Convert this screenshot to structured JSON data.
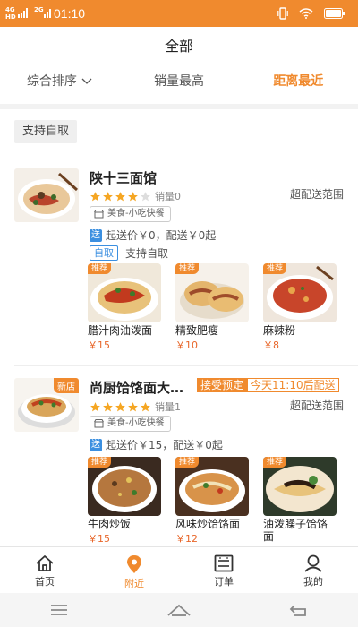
{
  "status_bar": {
    "net_top": "4G",
    "net_sub": "HD",
    "net2_top": "2G",
    "net2_sub": "",
    "time": "01:10"
  },
  "header": {
    "title": "全部"
  },
  "sort_tabs": [
    {
      "label": "综合排序"
    },
    {
      "label": "销量最高"
    },
    {
      "label": "距离最近"
    }
  ],
  "filter": {
    "label": "支持自取"
  },
  "shops": [
    {
      "name": "陕十三面馆",
      "rating": 4,
      "sales": "销量0",
      "range": "超配送范围",
      "category": "美食-小吃快餐",
      "delivery_badge": "送",
      "delivery": "起送价￥0，配送￥0起",
      "pickup_badge": "自取",
      "pickup_text": "支持自取",
      "dishes": [
        {
          "badge": "推荐",
          "name": "腊汁肉油泼面",
          "price": "￥15"
        },
        {
          "badge": "推荐",
          "name": "精致肥瘦",
          "price": "￥10"
        },
        {
          "badge": "推荐",
          "name": "麻辣粉",
          "price": "￥8"
        }
      ]
    },
    {
      "name": "尚厨饸饹面大…",
      "new_badge": "新店",
      "pre_badge": "接受预定",
      "pre_time": "今天11:10后配送",
      "rating": 5,
      "sales": "销量1",
      "range": "超配送范围",
      "category": "美食-小吃快餐",
      "delivery_badge": "送",
      "delivery": "起送价￥15，配送￥0起",
      "dishes": [
        {
          "badge": "推荐",
          "name": "牛肉炒饭",
          "price": "￥15"
        },
        {
          "badge": "推荐",
          "name": "风味炒饸饹面",
          "price": "￥12"
        },
        {
          "badge": "推荐",
          "name": "油泼臊子饸饹面",
          "price": ""
        }
      ]
    }
  ],
  "bottom_nav": [
    {
      "label": "首页",
      "icon": "home-icon"
    },
    {
      "label": "附近",
      "icon": "location-pin-icon"
    },
    {
      "label": "订单",
      "icon": "order-list-icon"
    },
    {
      "label": "我的",
      "icon": "profile-icon"
    }
  ],
  "colors": {
    "accent": "#f08a2e",
    "blue": "#3b8fe0",
    "price": "#e8672b"
  }
}
